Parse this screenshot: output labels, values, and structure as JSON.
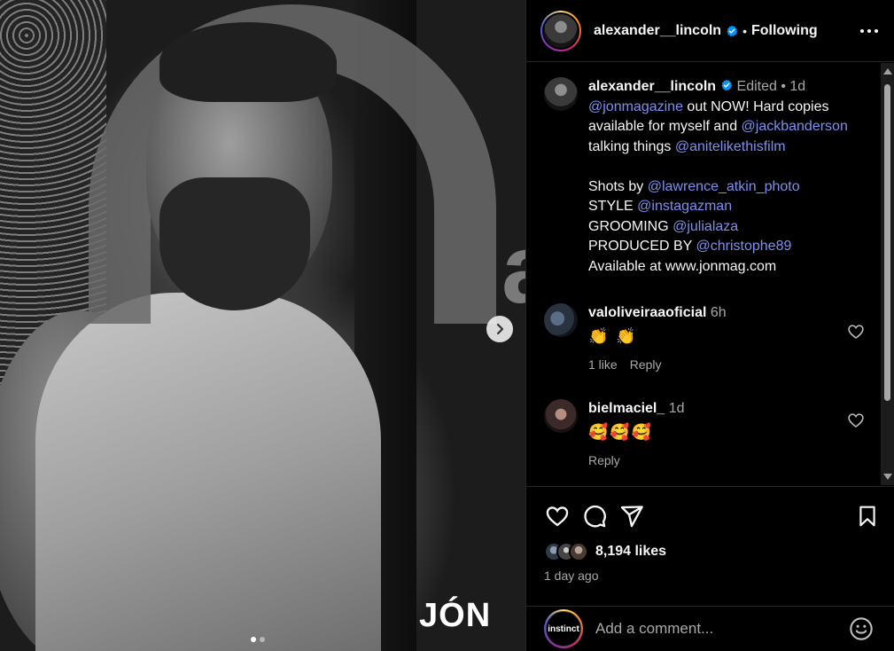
{
  "media": {
    "background_text": "a",
    "brand_logo": "JÓN",
    "next_icon": "chevron-right-icon",
    "dots_total": 2,
    "dot_active": 1
  },
  "post_header": {
    "username": "alexander__lincoln",
    "separator": "•",
    "follow_state": "Following",
    "more_icon": "more-horizontal-icon",
    "verified_icon": "verified-badge-icon"
  },
  "caption": {
    "username": "alexander__lincoln",
    "edited": "Edited",
    "separator": "•",
    "time": "1d",
    "line1_mention": "@jonmagazine",
    "line1_rest": " out NOW! Hard copies available for myself and ",
    "line2_mention": "@jackbanderson",
    "line2_rest": " talking things ",
    "line3_mention": "@anitelikethisfilm",
    "shots_label": "Shots by ",
    "shots_mention": "@lawrence_atkin_photo",
    "style_label": "STYLE ",
    "style_mention": "@instagazman",
    "grooming_label": "GROOMING ",
    "grooming_mention": "@julialaza",
    "produced_label": "PRODUCED BY ",
    "produced_mention": "@christophe89",
    "available_line": "Available at www.jonmag.com"
  },
  "comments": [
    {
      "username": "valoliveiraaoficial",
      "time": "6h",
      "emoji": "👏 👏",
      "likes": "1 like",
      "reply": "Reply"
    },
    {
      "username": "bielmaciel_",
      "time": "1d",
      "emoji": "🥰🥰🥰",
      "reply": "Reply"
    }
  ],
  "actions": {
    "like_icon": "heart-icon",
    "comment_icon": "comment-icon",
    "share_icon": "send-icon",
    "save_icon": "bookmark-icon",
    "likes": "8,194 likes",
    "time_ago": "1 day ago"
  },
  "add_comment": {
    "avatar_text": "instinct",
    "placeholder": "Add a comment...",
    "emoji_icon": "smiley-icon"
  },
  "colors": {
    "mention": "#7d8ff0",
    "muted": "#a8a8a8",
    "verified": "#0095f6"
  }
}
